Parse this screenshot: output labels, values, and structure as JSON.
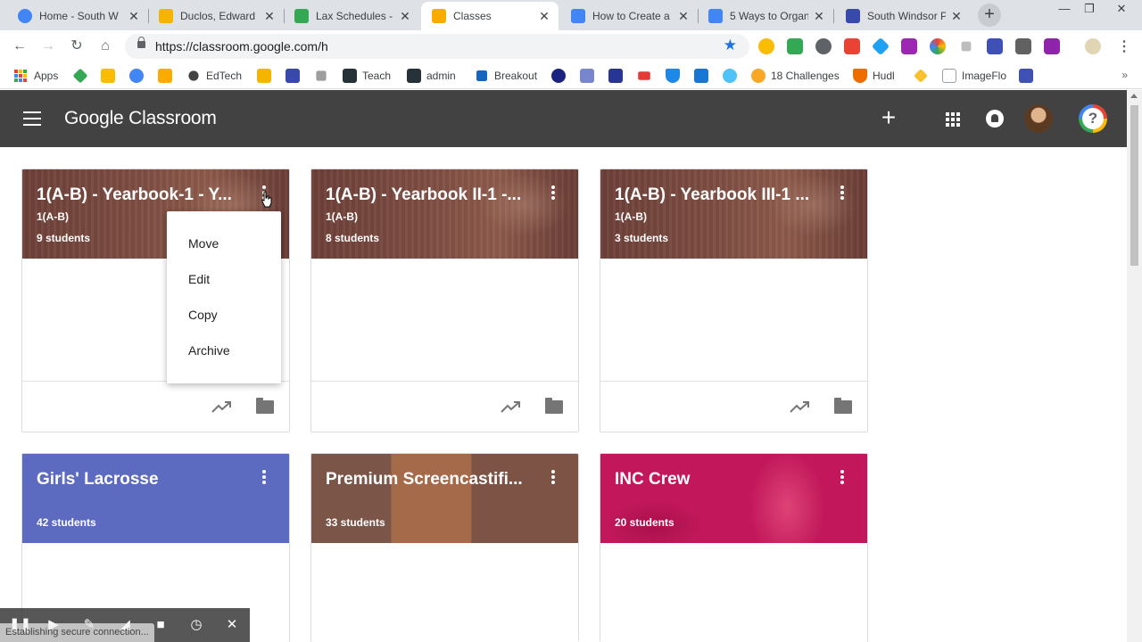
{
  "browser": {
    "tabs": [
      {
        "title": "Home - South W",
        "color": "#4285f4"
      },
      {
        "title": "Duclos, Edward -",
        "color": "#f4b400"
      },
      {
        "title": "Lax Schedules -",
        "color": "#34a853"
      },
      {
        "title": "Classes",
        "color": "#f9ab00"
      },
      {
        "title": "How to Create a",
        "color": "#4285f4"
      },
      {
        "title": "5 Ways to Organ",
        "color": "#4285f4"
      },
      {
        "title": "South Windsor P",
        "color": "#3949ab"
      }
    ],
    "url": "https://classroom.google.com/h",
    "bookmarks": [
      {
        "label": "Apps"
      },
      {
        "label": ""
      },
      {
        "label": ""
      },
      {
        "label": ""
      },
      {
        "label": ""
      },
      {
        "label": "EdTech"
      },
      {
        "label": ""
      },
      {
        "label": ""
      },
      {
        "label": ""
      },
      {
        "label": "Teach"
      },
      {
        "label": "admin"
      },
      {
        "label": "Breakout"
      },
      {
        "label": "18 Challenges"
      },
      {
        "label": "Hudl"
      },
      {
        "label": "ImageFlo"
      }
    ],
    "more_glyph": "»"
  },
  "header": {
    "title": "Google Classroom"
  },
  "classes": [
    {
      "name": "1(A-B) - Yearbook-1 - Y...",
      "section": "1(A-B)",
      "students": "9 students",
      "theme": "wood"
    },
    {
      "name": "1(A-B) - Yearbook II-1 -...",
      "section": "1(A-B)",
      "students": "8 students",
      "theme": "wood"
    },
    {
      "name": "1(A-B) - Yearbook III-1 ...",
      "section": "1(A-B)",
      "students": "3 students",
      "theme": "wood"
    },
    {
      "name": "Girls' Lacrosse",
      "section": "",
      "students": "42 students",
      "theme": "purple"
    },
    {
      "name": "Premium Screencastifi...",
      "section": "",
      "students": "33 students",
      "theme": "screencast"
    },
    {
      "name": "INC Crew",
      "section": "",
      "students": "20 students",
      "theme": "pink"
    }
  ],
  "menu": {
    "items": [
      "Move",
      "Edit",
      "Copy",
      "Archive"
    ]
  },
  "status_text": "Establishing secure connection...",
  "colors": {
    "header_bg": "#424242",
    "lacrosse": "#5c6bc0",
    "inc_crew": "#c2185b"
  }
}
